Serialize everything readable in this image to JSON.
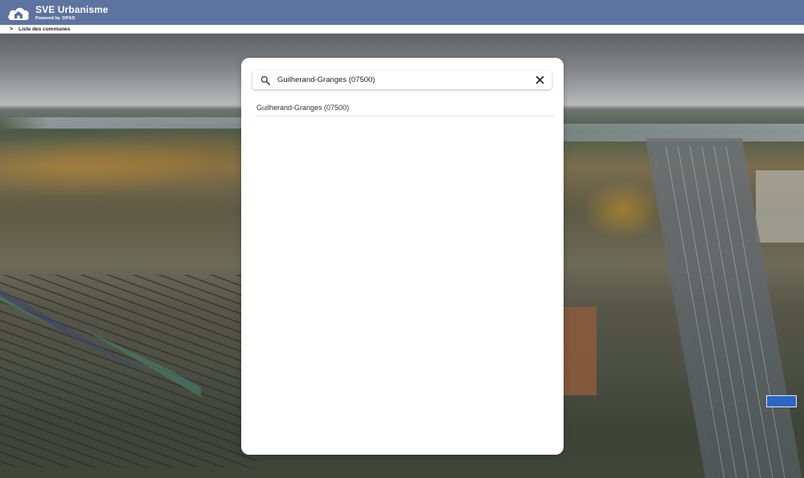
{
  "header": {
    "title": "SVE Urbanisme",
    "powered_by": "Powered by",
    "powered_brand": "3IPAD",
    "logo_icon": "cloud-house-icon"
  },
  "breadcrumb": {
    "chevron": ">",
    "link_label": "Liste des communes"
  },
  "search": {
    "value": "Guilherand-Granges (07500)",
    "icon": "search-icon",
    "clear_icon": "close-icon"
  },
  "results": [
    {
      "label": "Guilherand-Granges (07500)"
    }
  ],
  "colors": {
    "topbar": "#5d74a1",
    "modal": "#ffffff"
  }
}
